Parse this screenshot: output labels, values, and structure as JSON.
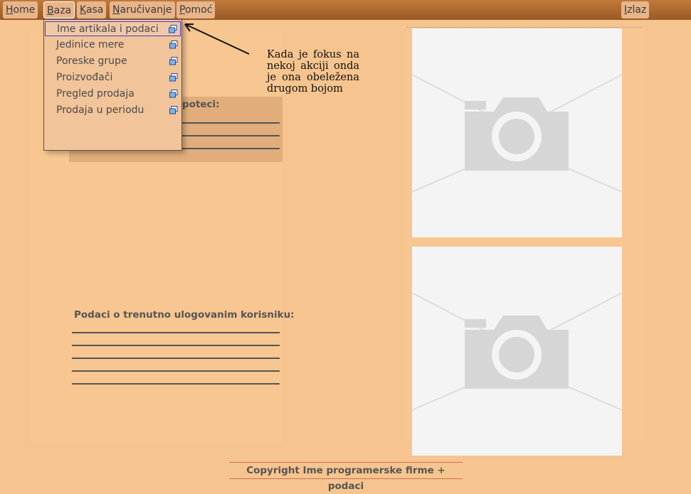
{
  "menubar": {
    "home": {
      "accel": "H",
      "rest": "ome"
    },
    "baza": {
      "accel": "B",
      "rest": "aza"
    },
    "kasa": {
      "accel": "K",
      "rest": "asa"
    },
    "narucivanje": {
      "accel": "N",
      "rest": "aručivanje"
    },
    "pomoc": {
      "accel": "P",
      "rest": "omoć"
    },
    "izlaz": {
      "accel": "I",
      "rest": "zlaz"
    }
  },
  "dropdown": {
    "items": [
      {
        "label": "Ime artikala i podaci"
      },
      {
        "label": "Jedinice mere"
      },
      {
        "label": "Poreske grupe"
      },
      {
        "label": "Proizvođači"
      },
      {
        "label": "Pregled prodaja"
      },
      {
        "label": "Prodaja u periodu"
      }
    ]
  },
  "sections": {
    "first_title_visible": "poteci:",
    "second_title": "Podaci o trenutno ulogovanim korisniku:"
  },
  "annotation": {
    "text": "Kada je fokus na nekoj akciji onda je ona obeležena drugom bojom"
  },
  "footer": {
    "text": "Copyright   Ime programerske firme +  podaci"
  },
  "icons": {
    "submenu": "window-icon",
    "photo": "camera-icon"
  }
}
